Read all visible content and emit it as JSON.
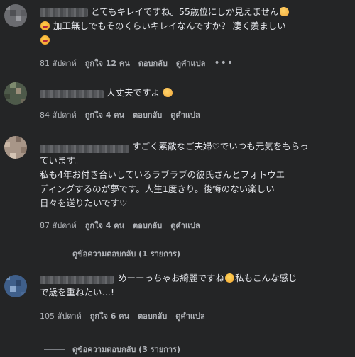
{
  "comments": [
    {
      "text_line1": "とてもキレイですね。55歳位にしか見えません",
      "text_line2": "加工無しでもそのくらいキレイなんですか？ 凄く羨ましい",
      "time": "81 สัปดาห์",
      "like": "ถูกใจ 12 คน",
      "reply": "ตอบกลับ",
      "translate": "ดูคำแปล",
      "more": "•••",
      "emojis": [
        "clap-emoji",
        "grin-emoji",
        "grin-emoji"
      ]
    },
    {
      "text_line1": "大丈夫ですよ",
      "time": "84 สัปดาห์",
      "like": "ถูกใจ 4 คน",
      "reply": "ตอบกลับ",
      "translate": "ดูคำแปล",
      "emojis": [
        "clap-emoji"
      ]
    },
    {
      "text_line1": "すごく素敵なご夫婦♡でいつも元気をもらっ",
      "text_line2": "ています。",
      "text_line3": "私も4年お付き合いしているラブラブの彼氏さんとフォトウエ",
      "text_line4": "ディングするのが夢です。人生1度きり。後悔のない楽しい",
      "text_line5": "日々を送りたいです♡",
      "time": "87 สัปดาห์",
      "like": "ถูกใจ 4 คน",
      "reply": "ตอบกลับ",
      "translate": "ดูคำแปล",
      "view_replies": "ดูข้อความตอบกลับ (1 รายการ)"
    },
    {
      "text_line1a": "めーーっちゃお綺麗ですね",
      "text_line1b": "私もこんな感じ",
      "text_line2": "で歳を重ねたい…!",
      "time": "105 สัปดาห์",
      "like": "ถูกใจ 6 คน",
      "reply": "ตอบกลับ",
      "translate": "ดูคำแปล",
      "view_replies": "ดูข้อความตอบกลับ (3 รายการ)",
      "emojis": [
        "flushed-emoji"
      ]
    }
  ],
  "colors": {
    "background": "#242526",
    "text": "#e4e6eb",
    "secondary": "#b0b3b8"
  }
}
